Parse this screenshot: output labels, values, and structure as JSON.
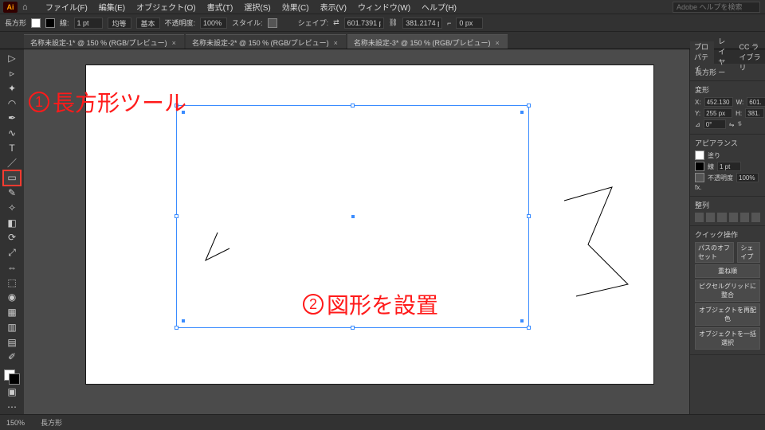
{
  "menubar": {
    "items": [
      "ファイル(F)",
      "編集(E)",
      "オブジェクト(O)",
      "書式(T)",
      "選択(S)",
      "効果(C)",
      "表示(V)",
      "ウィンドウ(W)",
      "ヘルプ(H)"
    ],
    "search_placeholder": "Adobe ヘルプを検索"
  },
  "options": {
    "tool_label": "長方形",
    "stroke_pt": "1 pt",
    "align_label": "均等",
    "profile_label": "基本",
    "opacity_label": "不透明度:",
    "opacity_val": "100%",
    "style_label": "スタイル:",
    "shape_label": "シェイプ:",
    "w_val": "601.7391 p",
    "h_val": "381.2174 p",
    "corner_val": "0 px"
  },
  "tabs": [
    {
      "label": "名称未設定-1* @ 150 % (RGB/プレビュー)",
      "close": "×"
    },
    {
      "label": "名称未設定-2* @ 150 % (RGB/プレビュー)",
      "close": "×"
    },
    {
      "label": "名称未設定-3* @ 150 % (RGB/プレビュー)",
      "close": "×"
    }
  ],
  "active_tab": 2,
  "annotations": {
    "one_num": "1",
    "one_label": "長方形ツール",
    "two_num": "2",
    "two_label": "図形を設置"
  },
  "panels": {
    "tabs": [
      "プロパティ",
      "レイヤー",
      "CC ライブラリ"
    ],
    "shape_type": "長方形",
    "transform": {
      "header": "変形",
      "x": "452.130",
      "w": "601.",
      "y": "255 px",
      "h": "381.",
      "rot": "0°"
    },
    "appearance": {
      "header": "アピアランス",
      "fill": "塗り",
      "stroke": "線",
      "stroke_pt": "1 pt",
      "opacity_label": "不透明度",
      "opacity": "100%",
      "fx": "fx."
    },
    "align": {
      "header": "整列"
    },
    "quick": {
      "header": "クイック操作",
      "btns": [
        "パスのオフセット",
        "シェイプ",
        "重ね順",
        "ピクセルグリッドに整合",
        "オブジェクトを再配色",
        "オブジェクトを一括選択"
      ]
    }
  },
  "status": {
    "zoom": "150%",
    "mode": "長方形"
  }
}
